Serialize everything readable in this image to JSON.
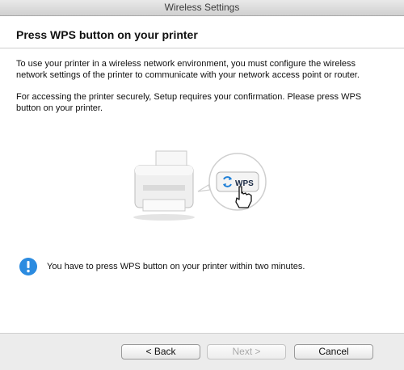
{
  "window": {
    "title": "Wireless Settings"
  },
  "content": {
    "heading": "Press WPS button on your printer",
    "paragraph1": "To use your printer in a wireless network environment, you must configure the wireless network settings of the printer to communicate with your network access point or router.",
    "paragraph2": "For accessing the printer securely, Setup requires your confirmation. Please press WPS button on your printer.",
    "wps_label": "WPS",
    "notice": "You have to press WPS button on your printer within two minutes."
  },
  "buttons": {
    "back": "< Back",
    "next": "Next >",
    "cancel": "Cancel"
  },
  "icons": {
    "illustration": "printer-icon",
    "wps": "wps-button-icon",
    "cursor": "hand-cursor-icon",
    "notice": "info-icon"
  },
  "colors": {
    "accent": "#1f7fd6",
    "info": "#2b8be0"
  }
}
